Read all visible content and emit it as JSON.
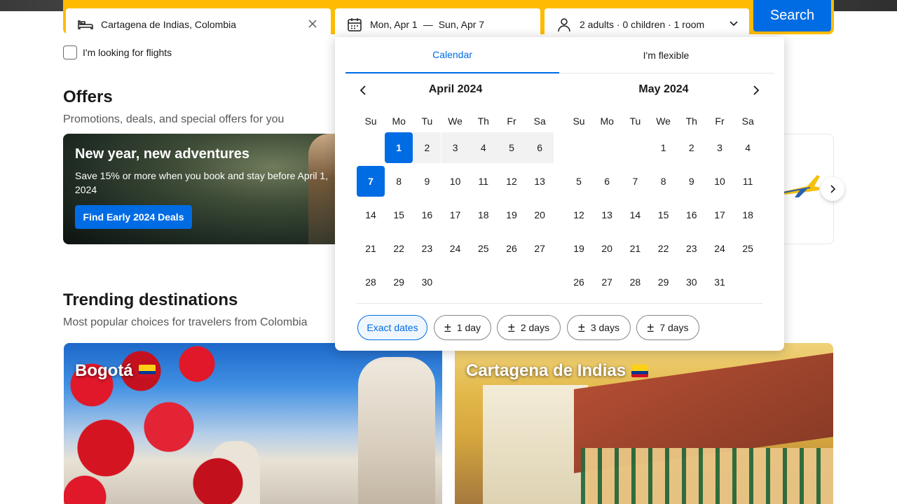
{
  "search": {
    "destination": "Cartagena de Indias, Colombia",
    "dates": {
      "start": "Mon, Apr 1",
      "separator": "—",
      "end": "Sun, Apr 7"
    },
    "guests": "2 adults · 0 children · 1 room",
    "button": "Search"
  },
  "flights_label": "I'm looking for flights",
  "offers": {
    "title": "Offers",
    "subtitle": "Promotions, deals, and special offers for you",
    "card": {
      "title": "New year, new adventures",
      "text": "Save 15% or more when you book and stay before April 1, 2024",
      "button": "Find Early 2024 Deals"
    }
  },
  "trending": {
    "title": "Trending destinations",
    "subtitle": "Most popular choices for travelers from Colombia",
    "cards": [
      {
        "name": "Bogotá"
      },
      {
        "name": "Cartagena de Indias"
      }
    ]
  },
  "calendar": {
    "tabs": [
      "Calendar",
      "I'm flexible"
    ],
    "active_tab": "Calendar",
    "weekdays": [
      "Su",
      "Mo",
      "Tu",
      "We",
      "Th",
      "Fr",
      "Sa"
    ],
    "months": [
      {
        "title": "April 2024",
        "weeks": [
          [
            "",
            "1",
            "2",
            "3",
            "4",
            "5",
            "6"
          ],
          [
            "7",
            "8",
            "9",
            "10",
            "11",
            "12",
            "13"
          ],
          [
            "14",
            "15",
            "16",
            "17",
            "18",
            "19",
            "20"
          ],
          [
            "21",
            "22",
            "23",
            "24",
            "25",
            "26",
            "27"
          ],
          [
            "28",
            "29",
            "30",
            "",
            "",
            "",
            ""
          ]
        ]
      },
      {
        "title": "May 2024",
        "weeks": [
          [
            "",
            "",
            "",
            "1",
            "2",
            "3",
            "4"
          ],
          [
            "5",
            "6",
            "7",
            "8",
            "9",
            "10",
            "11"
          ],
          [
            "12",
            "13",
            "14",
            "15",
            "16",
            "17",
            "18"
          ],
          [
            "19",
            "20",
            "21",
            "22",
            "23",
            "24",
            "25"
          ],
          [
            "26",
            "27",
            "28",
            "29",
            "30",
            "31",
            ""
          ]
        ]
      }
    ],
    "selected_start": "1",
    "selected_end": "7",
    "flex_options": [
      {
        "pm": "",
        "label": "Exact dates"
      },
      {
        "pm": "±",
        "label": "1 day"
      },
      {
        "pm": "±",
        "label": "2 days"
      },
      {
        "pm": "±",
        "label": "3 days"
      },
      {
        "pm": "±",
        "label": "7 days"
      }
    ]
  },
  "colors": {
    "brand_blue": "#006ce4",
    "search_yellow": "#febb02",
    "range_gray": "#f2f2f2"
  }
}
